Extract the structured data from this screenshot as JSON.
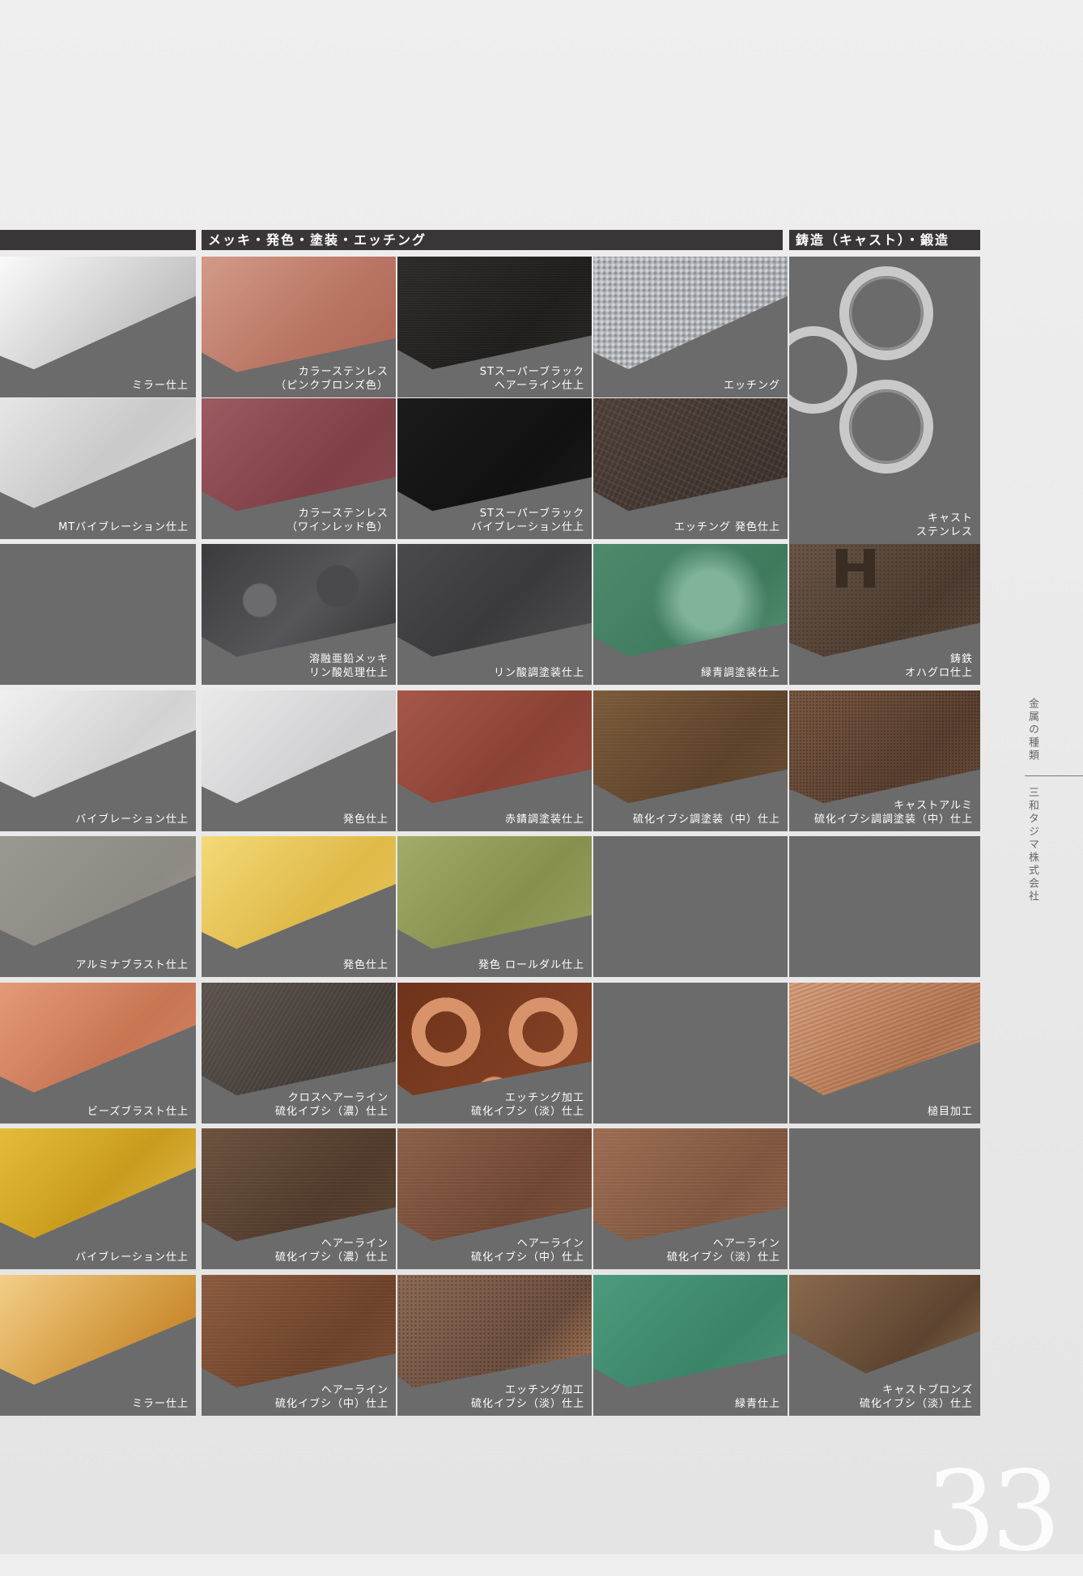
{
  "headers": {
    "col1": "",
    "plating": "メッキ・発色・塗装・エッチング",
    "cast": "鋳造（キャスト）・鍛造"
  },
  "cells": {
    "a1": "ミラー仕上",
    "a2": "MTバイブレーション仕上",
    "a4": "バイブレーション仕上",
    "a5": "アルミナブラスト仕上",
    "a6": "ビーズブラスト仕上",
    "a7": "バイブレーション仕上",
    "a8": "ミラー仕上",
    "b1": "カラーステンレス\n（ピンクブロンズ色）",
    "b2": "カラーステンレス\n（ワインレッド色）",
    "b3": "溶融亜鉛メッキ\nリン酸処理仕上",
    "b4": "発色仕上",
    "b5": "発色仕上",
    "b6": "クロスヘアーライン\n硫化イブシ（濃）仕上",
    "b7": "ヘアーライン\n硫化イブシ（濃）仕上",
    "b8": "ヘアーライン\n硫化イブシ（中）仕上",
    "c1": "STスーパーブラック\nヘアーライン仕上",
    "c2": "STスーパーブラック\nバイブレーション仕上",
    "c3": "リン酸調塗装仕上",
    "c4": "赤錆調塗装仕上",
    "c5": "発色 ロールダル仕上",
    "c6": "エッチング加工\n硫化イブシ（淡）仕上",
    "c7": "ヘアーライン\n硫化イブシ（中）仕上",
    "c8": "エッチング加工\n硫化イブシ（淡）仕上",
    "d1": "エッチング",
    "d2": "エッチング 発色仕上",
    "d3": "緑青調塗装仕上",
    "d4": "硫化イブシ調塗装（中）仕上",
    "d7": "ヘアーライン\n硫化イブシ（淡）仕上",
    "d8": "緑青仕上",
    "e1": "キャスト\nステンレス",
    "e3": "鋳鉄\nオハグロ仕上",
    "e4": "キャストアルミ\n硫化イブシ調調塗装（中）仕上",
    "e6": "槌目加工",
    "e8": "キャストブロンズ\n硫化イブシ（淡）仕上"
  },
  "side": {
    "category": "金属の種類",
    "company": "三和タジマ株式会社"
  },
  "page_number": "33",
  "colors": {
    "header_bg": "#3a3636",
    "cell_bg": "#6b6b6b"
  }
}
